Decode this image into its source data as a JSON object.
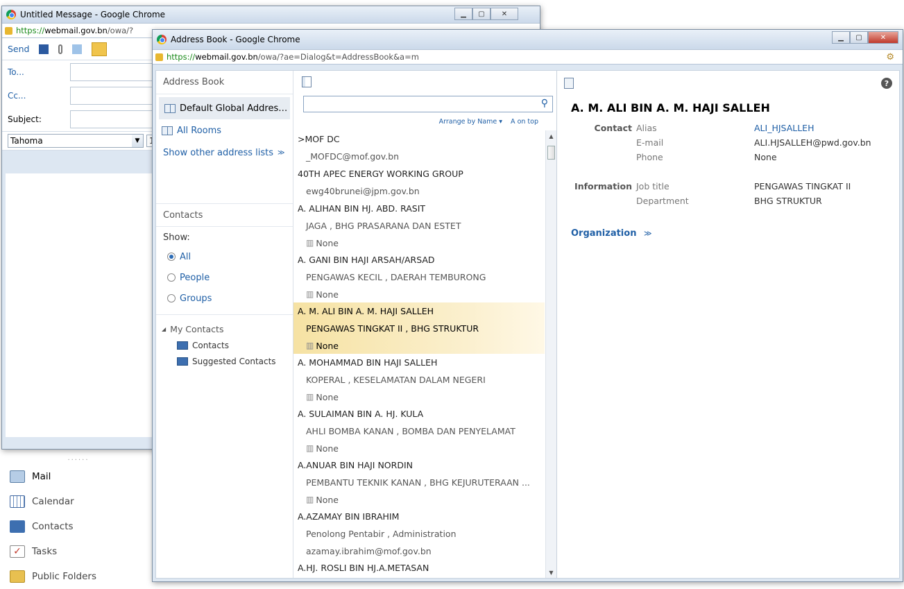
{
  "compose_window": {
    "title": "Untitled Message - Google Chrome",
    "url_https": "https://",
    "url_host": "webmail.gov.bn",
    "url_rest": "/owa/?",
    "toolbar": {
      "send_label": "Send"
    },
    "to_label": "To...",
    "cc_label": "Cc...",
    "subject_label": "Subject:",
    "font_name": "Tahoma",
    "font_size": "1"
  },
  "nav": {
    "grip": "......",
    "items": [
      {
        "label": "Mail",
        "icon": "mail-icon"
      },
      {
        "label": "Calendar",
        "icon": "calendar-icon"
      },
      {
        "label": "Contacts",
        "icon": "contacts-icon"
      },
      {
        "label": "Tasks",
        "icon": "tasks-icon"
      },
      {
        "label": "Public Folders",
        "icon": "public-folders-icon"
      }
    ]
  },
  "address_book_window": {
    "title": "Address Book - Google Chrome",
    "url_https": "https://",
    "url_host": "webmail.gov.bn",
    "url_rest": "/owa/?ae=Dialog&t=AddressBook&a=m"
  },
  "left_panel": {
    "header": "Address Book",
    "default_list": "Default Global Addres…",
    "all_rooms": "All Rooms",
    "show_other": "Show other address lists",
    "contacts_header": "Contacts",
    "show_label": "Show:",
    "filters": [
      "All",
      "People",
      "Groups"
    ],
    "selected_filter": "All",
    "my_contacts": "My Contacts",
    "tree": [
      "Contacts",
      "Suggested Contacts"
    ]
  },
  "list_panel": {
    "search_placeholder": "",
    "arrange_by": "Arrange by Name",
    "order": "A on top",
    "entries": [
      {
        "name": ">MOF DC",
        "sub": "_MOFDC@mof.gov.bn",
        "phone": ""
      },
      {
        "name": "40TH APEC ENERGY WORKING GROUP",
        "sub": "ewg40brunei@jpm.gov.bn",
        "phone": ""
      },
      {
        "name": "A. ALIHAN BIN HJ. ABD. RASIT",
        "sub": "JAGA , BHG PRASARANA DAN ESTET",
        "phone": "None"
      },
      {
        "name": "A. GANI BIN HAJI ARSAH/ARSAD",
        "sub": "PENGAWAS KECIL , DAERAH TEMBURONG",
        "phone": "None"
      },
      {
        "name": "A. M. ALI BIN A. M. HAJI SALLEH",
        "sub": "PENGAWAS TINGKAT II , BHG STRUKTUR",
        "phone": "None",
        "selected": true
      },
      {
        "name": "A. MOHAMMAD BIN HAJI SALLEH",
        "sub": "KOPERAL , KESELAMATAN DALAM NEGERI",
        "phone": "None"
      },
      {
        "name": "A. SULAIMAN BIN A. HJ. KULA",
        "sub": "AHLI BOMBA KANAN , BOMBA DAN PENYELAMAT",
        "phone": "None"
      },
      {
        "name": "A.ANUAR BIN HAJI NORDIN",
        "sub": "PEMBANTU TEKNIK KANAN , BHG KEJURUTERAAN ...",
        "phone": "None"
      },
      {
        "name": "A.AZAMAY BIN IBRAHIM",
        "sub": "Penolong Pentabir , Administration",
        "phone": "azamay.ibrahim@mof.gov.bn"
      },
      {
        "name": "A.HJ. ROSLI BIN HJ.A.METASAN",
        "sub": "",
        "phone": ""
      }
    ]
  },
  "detail": {
    "name": "A. M. ALI BIN A. M. HAJI SALLEH",
    "contact_heading": "Contact",
    "alias_label": "Alias",
    "alias_value": "ALI_HJSALLEH",
    "email_label": "E-mail",
    "email_value": "ALI.HJSALLEH@pwd.gov.bn",
    "phone_label": "Phone",
    "phone_value": "None",
    "info_heading": "Information",
    "jobtitle_label": "Job title",
    "jobtitle_value": "PENGAWAS TINGKAT II",
    "department_label": "Department",
    "department_value": "BHG STRUKTUR",
    "organization": "Organization"
  },
  "colors": {
    "accent": "#1f5fa6",
    "selected_row": "#f6e2a3"
  }
}
